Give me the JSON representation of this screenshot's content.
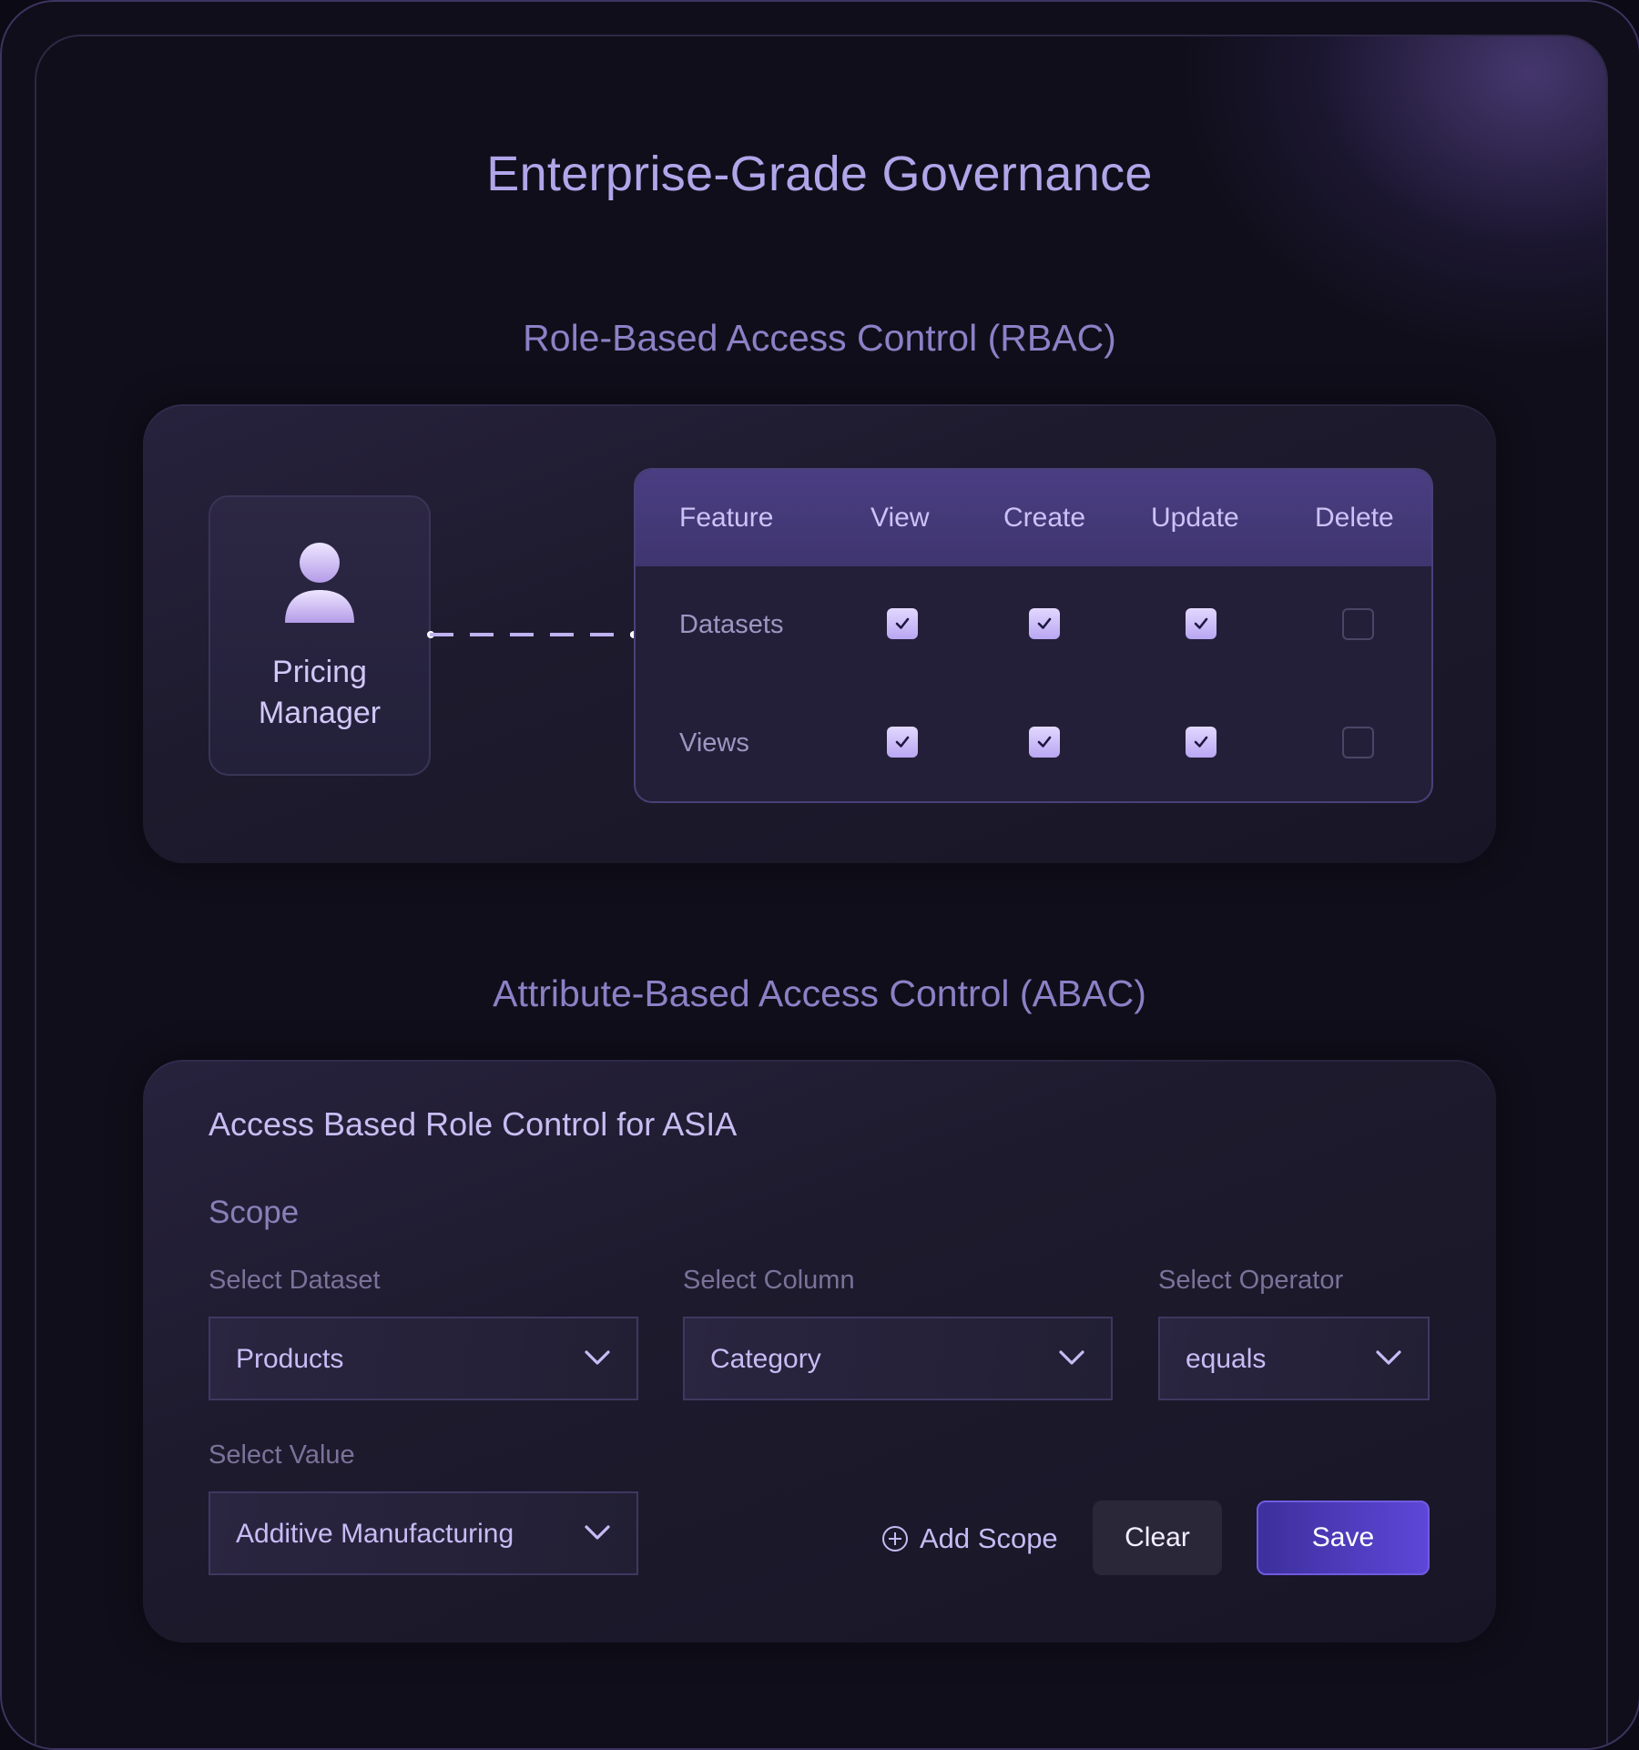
{
  "page": {
    "title": "Enterprise-Grade Governance"
  },
  "rbac": {
    "section_title": "Role-Based Access Control (RBAC)",
    "role": {
      "icon": "user-icon",
      "label_line1": "Pricing",
      "label_line2": "Manager"
    },
    "table": {
      "headers": [
        "Feature",
        "View",
        "Create",
        "Update",
        "Delete"
      ],
      "rows": [
        {
          "feature": "Datasets",
          "permissions": [
            true,
            true,
            true,
            false
          ]
        },
        {
          "feature": "Views",
          "permissions": [
            true,
            true,
            true,
            false
          ]
        }
      ]
    }
  },
  "abac": {
    "section_title": "Attribute-Based Access Control (ABAC)",
    "card_title": "Access Based Role Control for ASIA",
    "scope_label": "Scope",
    "fields": {
      "dataset": {
        "label": "Select Dataset",
        "value": "Products"
      },
      "column": {
        "label": "Select Column",
        "value": "Category"
      },
      "operator": {
        "label": "Select Operator",
        "value": "equals"
      },
      "value": {
        "label": "Select Value",
        "value": "Additive Manufacturing"
      }
    },
    "actions": {
      "add_scope": "Add Scope",
      "clear": "Clear",
      "save": "Save"
    }
  },
  "colors": {
    "accent": "#5d47d8",
    "title": "#b1a5ea",
    "checkbox_on": "#c9b8f7"
  }
}
